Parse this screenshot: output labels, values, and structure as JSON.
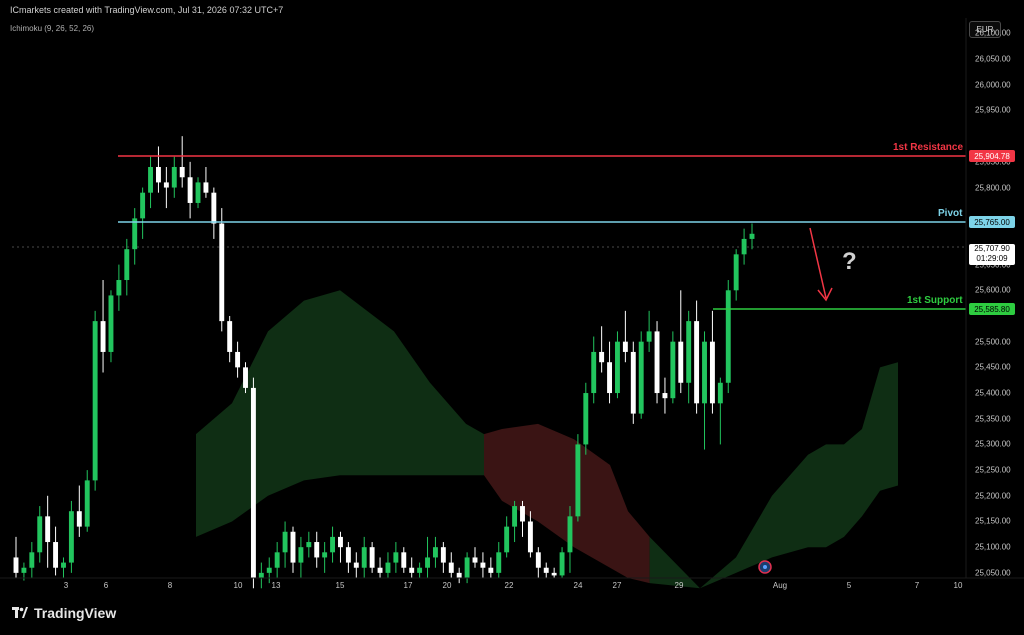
{
  "header": {
    "attribution": "ICmarkets created with TradingView.com, Jul 31, 2026 07:32 UTC+7",
    "indicator": "Ichimoku (9, 26, 52, 26)"
  },
  "currency_button": "EUR",
  "price_axis": [
    "26,100.00",
    "26,050.00",
    "26,000.00",
    "25,950.00",
    "25,850.00",
    "25,800.00",
    "25,650.00",
    "25,600.00",
    "25,500.00",
    "25,450.00",
    "25,400.00",
    "25,350.00",
    "25,300.00",
    "25,250.00",
    "25,200.00",
    "25,150.00",
    "25,100.00",
    "25,050.00"
  ],
  "time_axis": [
    "3",
    "6",
    "8",
    "10",
    "13",
    "15",
    "17",
    "20",
    "22",
    "24",
    "27",
    "29",
    "Aug",
    "5",
    "7",
    "10"
  ],
  "levels": {
    "resistance": {
      "label": "1st Resistance",
      "value": "25,904.78",
      "color": "#f23645"
    },
    "pivot": {
      "label": "Pivot",
      "value": "25,765.00",
      "color": "#7dd3e8"
    },
    "support": {
      "label": "1st Support",
      "value": "25,585.80",
      "color": "#2ecc40"
    }
  },
  "last_price": {
    "value": "25,707.90",
    "countdown": "01:29:09"
  },
  "annotation": {
    "question": "?"
  },
  "footer": {
    "brand": "TradingView"
  },
  "colors": {
    "up": "#22c55e",
    "down": "#ffffff",
    "cloud_bull": "#0f2e14",
    "cloud_bear": "#3a1414",
    "arrow": "#f23645"
  },
  "chart_data": {
    "type": "candlestick",
    "ylim": [
      25040,
      26130
    ],
    "candles": [
      [
        25080,
        25120,
        25040,
        25050
      ],
      [
        25050,
        25070,
        25035,
        25060
      ],
      [
        25060,
        25110,
        25040,
        25090
      ],
      [
        25090,
        25180,
        25070,
        25160
      ],
      [
        25160,
        25200,
        25060,
        25110
      ],
      [
        25110,
        25140,
        25045,
        25060
      ],
      [
        25060,
        25080,
        25040,
        25070
      ],
      [
        25070,
        25190,
        25050,
        25170
      ],
      [
        25170,
        25220,
        25120,
        25140
      ],
      [
        25140,
        25250,
        25130,
        25230
      ],
      [
        25230,
        25560,
        25210,
        25540
      ],
      [
        25540,
        25620,
        25440,
        25480
      ],
      [
        25480,
        25600,
        25460,
        25590
      ],
      [
        25590,
        25650,
        25560,
        25620
      ],
      [
        25620,
        25700,
        25590,
        25680
      ],
      [
        25680,
        25760,
        25650,
        25740
      ],
      [
        25740,
        25800,
        25700,
        25790
      ],
      [
        25790,
        25860,
        25760,
        25840
      ],
      [
        25840,
        25880,
        25790,
        25810
      ],
      [
        25810,
        25840,
        25760,
        25800
      ],
      [
        25800,
        25860,
        25780,
        25840
      ],
      [
        25840,
        25900,
        25800,
        25820
      ],
      [
        25820,
        25850,
        25740,
        25770
      ],
      [
        25770,
        25820,
        25760,
        25810
      ],
      [
        25810,
        25840,
        25780,
        25790
      ],
      [
        25790,
        25800,
        25700,
        25730
      ],
      [
        25730,
        25760,
        25520,
        25540
      ],
      [
        25540,
        25550,
        25460,
        25480
      ],
      [
        25480,
        25500,
        25430,
        25450
      ],
      [
        25450,
        25460,
        25400,
        25410
      ],
      [
        25410,
        25430,
        25020,
        25040
      ],
      [
        25040,
        25070,
        25020,
        25050
      ],
      [
        25050,
        25080,
        25030,
        25060
      ],
      [
        25060,
        25110,
        25040,
        25090
      ],
      [
        25090,
        25150,
        25060,
        25130
      ],
      [
        25130,
        25140,
        25050,
        25070
      ],
      [
        25070,
        25120,
        25040,
        25100
      ],
      [
        25100,
        25130,
        25080,
        25110
      ],
      [
        25110,
        25130,
        25060,
        25080
      ],
      [
        25080,
        25110,
        25050,
        25090
      ],
      [
        25090,
        25140,
        25070,
        25120
      ],
      [
        25120,
        25130,
        25070,
        25100
      ],
      [
        25100,
        25110,
        25050,
        25070
      ],
      [
        25070,
        25090,
        25040,
        25060
      ],
      [
        25060,
        25120,
        25040,
        25100
      ],
      [
        25100,
        25110,
        25050,
        25060
      ],
      [
        25060,
        25080,
        25040,
        25050
      ],
      [
        25050,
        25090,
        25040,
        25070
      ],
      [
        25070,
        25110,
        25050,
        25090
      ],
      [
        25090,
        25100,
        25050,
        25060
      ],
      [
        25060,
        25080,
        25040,
        25050
      ],
      [
        25050,
        25070,
        25040,
        25060
      ],
      [
        25060,
        25120,
        25040,
        25080
      ],
      [
        25080,
        25120,
        25060,
        25100
      ],
      [
        25100,
        25110,
        25050,
        25070
      ],
      [
        25070,
        25090,
        25040,
        25050
      ],
      [
        25050,
        25060,
        25030,
        25040
      ],
      [
        25040,
        25090,
        25030,
        25080
      ],
      [
        25080,
        25100,
        25060,
        25070
      ],
      [
        25070,
        25090,
        25040,
        25060
      ],
      [
        25060,
        25080,
        25040,
        25050
      ],
      [
        25050,
        25110,
        25040,
        25090
      ],
      [
        25090,
        25160,
        25080,
        25140
      ],
      [
        25140,
        25190,
        25110,
        25180
      ],
      [
        25180,
        25190,
        25120,
        25150
      ],
      [
        25150,
        25170,
        25080,
        25090
      ],
      [
        25090,
        25100,
        25040,
        25060
      ],
      [
        25060,
        25070,
        25040,
        25050
      ],
      [
        25050,
        25060,
        25040,
        25045
      ],
      [
        25045,
        25100,
        25040,
        25090
      ],
      [
        25090,
        25180,
        25050,
        25160
      ],
      [
        25160,
        25320,
        25150,
        25300
      ],
      [
        25300,
        25420,
        25280,
        25400
      ],
      [
        25400,
        25510,
        25380,
        25480
      ],
      [
        25480,
        25530,
        25440,
        25460
      ],
      [
        25460,
        25500,
        25380,
        25400
      ],
      [
        25400,
        25520,
        25390,
        25500
      ],
      [
        25500,
        25560,
        25460,
        25480
      ],
      [
        25480,
        25500,
        25340,
        25360
      ],
      [
        25360,
        25520,
        25350,
        25500
      ],
      [
        25500,
        25560,
        25480,
        25520
      ],
      [
        25520,
        25540,
        25380,
        25400
      ],
      [
        25400,
        25430,
        25360,
        25390
      ],
      [
        25390,
        25520,
        25380,
        25500
      ],
      [
        25500,
        25600,
        25400,
        25420
      ],
      [
        25420,
        25560,
        25380,
        25540
      ],
      [
        25540,
        25580,
        25360,
        25380
      ],
      [
        25380,
        25520,
        25290,
        25500
      ],
      [
        25500,
        25560,
        25360,
        25380
      ],
      [
        25380,
        25430,
        25300,
        25420
      ],
      [
        25420,
        25620,
        25400,
        25600
      ],
      [
        25600,
        25680,
        25580,
        25670
      ],
      [
        25670,
        25720,
        25650,
        25700
      ],
      [
        25700,
        25730,
        25680,
        25710
      ]
    ],
    "cloud": {
      "upper": [
        [
          0,
          25320
        ],
        [
          10,
          25380
        ],
        [
          20,
          25520
        ],
        [
          30,
          25580
        ],
        [
          40,
          25600
        ],
        [
          55,
          25520
        ],
        [
          65,
          25420
        ],
        [
          75,
          25340
        ],
        [
          80,
          25320
        ],
        [
          85,
          25330
        ],
        [
          95,
          25340
        ],
        [
          105,
          25310
        ],
        [
          115,
          25260
        ],
        [
          120,
          25170
        ],
        [
          126,
          25120
        ],
        [
          140,
          25020
        ],
        [
          150,
          25080
        ],
        [
          160,
          25200
        ],
        [
          170,
          25280
        ],
        [
          175,
          25300
        ],
        [
          180,
          25300
        ],
        [
          185,
          25330
        ],
        [
          190,
          25450
        ],
        [
          195,
          25460
        ]
      ],
      "lower": [
        [
          0,
          25120
        ],
        [
          10,
          25150
        ],
        [
          20,
          25200
        ],
        [
          30,
          25230
        ],
        [
          40,
          25240
        ],
        [
          55,
          25240
        ],
        [
          65,
          25240
        ],
        [
          75,
          25240
        ],
        [
          80,
          25240
        ],
        [
          85,
          25190
        ],
        [
          95,
          25150
        ],
        [
          105,
          25100
        ],
        [
          115,
          25060
        ],
        [
          120,
          25040
        ],
        [
          126,
          25030
        ],
        [
          140,
          25020
        ],
        [
          150,
          25050
        ],
        [
          160,
          25080
        ],
        [
          170,
          25100
        ],
        [
          175,
          25100
        ],
        [
          180,
          25120
        ],
        [
          185,
          25160
        ],
        [
          190,
          25210
        ],
        [
          195,
          25220
        ]
      ]
    }
  }
}
